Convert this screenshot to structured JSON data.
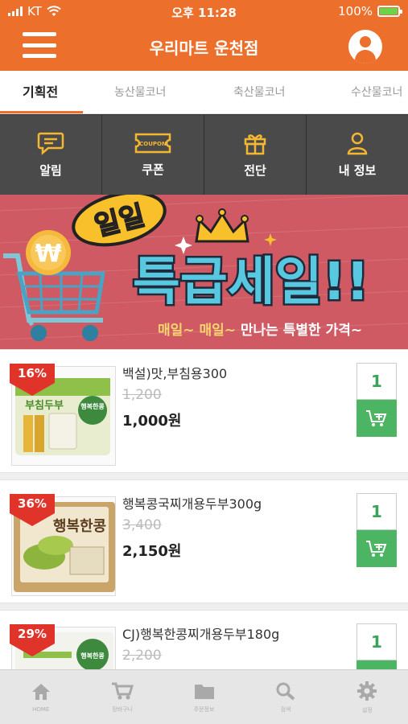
{
  "status": {
    "carrier": "KT",
    "time": "오후 11:28",
    "battery": "100%"
  },
  "header": {
    "title": "우리마트 운천점"
  },
  "tabs": [
    {
      "label": "기획전",
      "active": true
    },
    {
      "label": "농산물코너"
    },
    {
      "label": "축산물코너"
    },
    {
      "label": "수산물코너"
    }
  ],
  "quickmenu": [
    {
      "label": "알림",
      "icon": "chat-bubble-icon"
    },
    {
      "label": "쿠폰",
      "icon": "coupon-icon",
      "badge": "COUPON"
    },
    {
      "label": "전단",
      "icon": "gift-icon"
    },
    {
      "label": "내 정보",
      "icon": "user-icon"
    }
  ],
  "banner": {
    "badge": "일일",
    "headline": "특급세일!!",
    "subtitle_highlight": "매일~ 매일~",
    "subtitle": "만나는 특별한 가격~",
    "currency_symbol": "₩"
  },
  "products": [
    {
      "name": "백설)맛,부침용300",
      "discount": "16%",
      "old_price": "1,200",
      "price": "1,000원",
      "qty": "1",
      "thumb_text": "부침두부",
      "thumb_brand": "행복한콩"
    },
    {
      "name": "행복콩국찌개용두부300g",
      "discount": "36%",
      "old_price": "3,400",
      "price": "2,150원",
      "qty": "1",
      "thumb_text": "행복한콩"
    },
    {
      "name": "CJ)행복한콩찌개용두부180g",
      "discount": "29%",
      "old_price": "2,200",
      "price": "",
      "qty": "1",
      "thumb_text": "행복한콩"
    }
  ],
  "bottomnav": [
    {
      "label": "HOME",
      "icon": "home-icon"
    },
    {
      "label": "장바구니",
      "icon": "cart-icon"
    },
    {
      "label": "주문정보",
      "icon": "folder-icon"
    },
    {
      "label": "검색",
      "icon": "search-icon"
    },
    {
      "label": "설정",
      "icon": "gear-icon"
    }
  ],
  "colors": {
    "brand": "#ec6f2b",
    "cart_green": "#4bb563",
    "discount_red": "#e0342a",
    "banner_bg": "#cf5a63"
  }
}
